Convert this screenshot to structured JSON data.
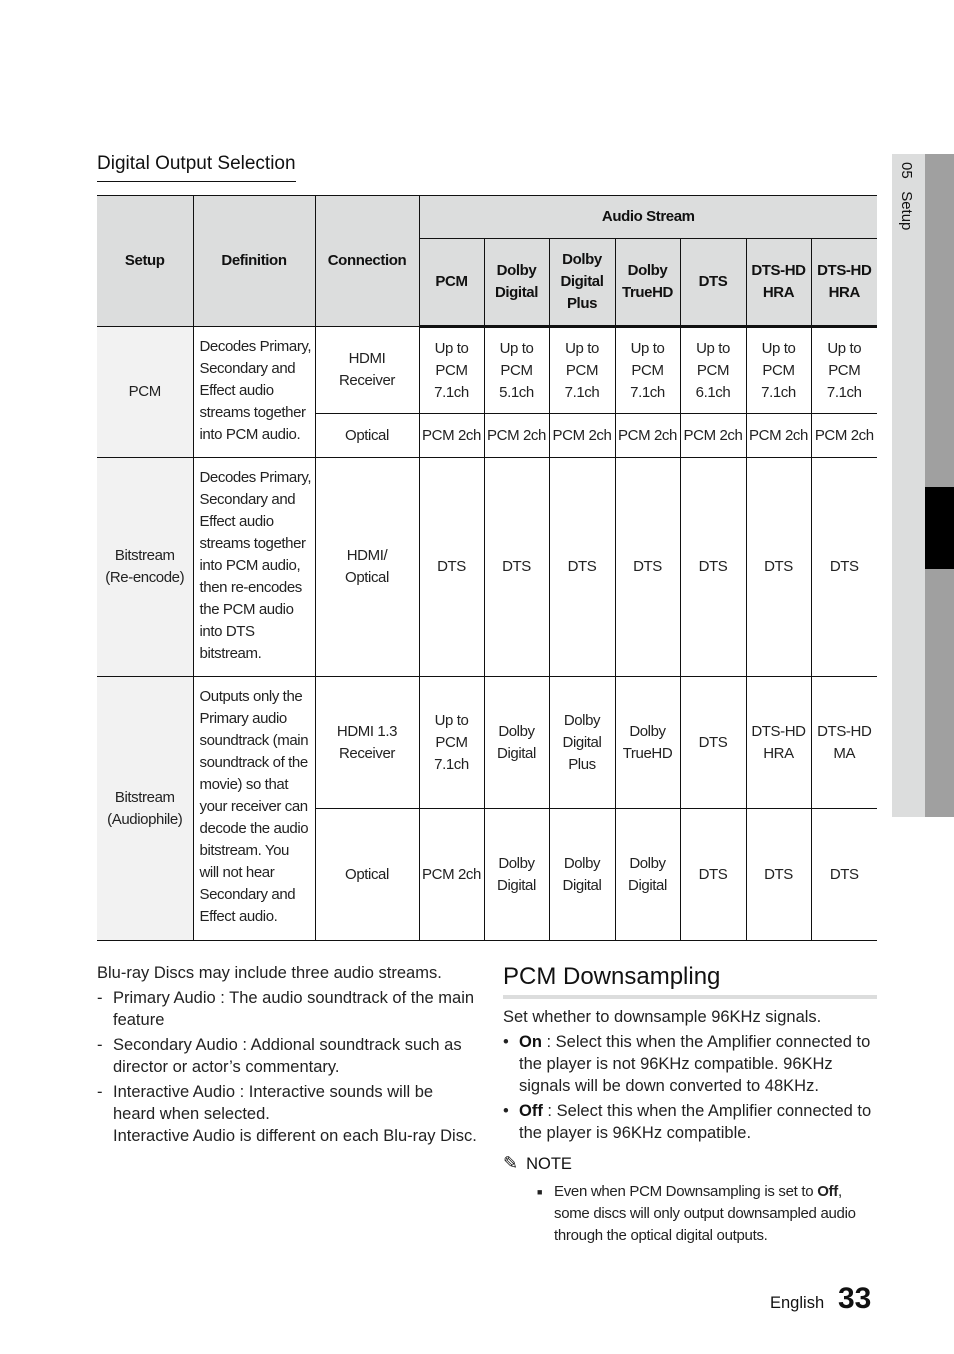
{
  "side_tab": {
    "chapter": "05",
    "label": "Setup"
  },
  "section_title": "Digital Output Selection",
  "table": {
    "headers": {
      "setup": "Setup",
      "definition": "Definition",
      "connection": "Connection",
      "audio_stream": "Audio Stream",
      "streams": [
        "PCM",
        "Dolby\nDigital",
        "Dolby\nDigital\nPlus",
        "Dolby\nTrueHD",
        "DTS",
        "DTS-HD\nHRA",
        "DTS-HD\nHRA"
      ]
    },
    "groups": [
      {
        "setup": "PCM",
        "definition": "Decodes Primary, Secondary and Effect audio streams together into PCM audio.",
        "rows": [
          {
            "connection": "HDMI\nReceiver",
            "values": [
              "Up to\nPCM\n7.1ch",
              "Up to\nPCM\n5.1ch",
              "Up to\nPCM\n7.1ch",
              "Up to\nPCM\n7.1ch",
              "Up to\nPCM\n6.1ch",
              "Up to\nPCM\n7.1ch",
              "Up to\nPCM\n7.1ch"
            ]
          },
          {
            "connection": "Optical",
            "values": [
              "PCM 2ch",
              "PCM 2ch",
              "PCM 2ch",
              "PCM 2ch",
              "PCM 2ch",
              "PCM 2ch",
              "PCM 2ch"
            ]
          }
        ]
      },
      {
        "setup": "Bitstream\n(Re-encode)",
        "definition": "Decodes Primary, Secondary and Effect audio streams together into PCM audio, then re-encodes the PCM audio into DTS bitstream.",
        "rows": [
          {
            "connection": "HDMI/\nOptical",
            "values": [
              "DTS",
              "DTS",
              "DTS",
              "DTS",
              "DTS",
              "DTS",
              "DTS"
            ]
          }
        ]
      },
      {
        "setup": "Bitstream\n(Audiophile)",
        "definition": "Outputs only the Primary audio soundtrack (main soundtrack of the movie) so that your receiver can decode the audio bitstream. You will not hear Secondary and Effect audio.",
        "rows": [
          {
            "connection": "HDMI 1.3\nReceiver",
            "values": [
              "Up to\nPCM\n7.1ch",
              "Dolby\nDigital",
              "Dolby\nDigital\nPlus",
              "Dolby\nTrueHD",
              "DTS",
              "DTS-HD\nHRA",
              "DTS-HD\nMA"
            ]
          },
          {
            "connection": "Optical",
            "values": [
              "PCM 2ch",
              "Dolby\nDigital",
              "Dolby\nDigital",
              "Dolby\nDigital",
              "DTS",
              "DTS",
              "DTS"
            ]
          }
        ]
      }
    ]
  },
  "left_notes": {
    "intro": "Blu-ray Discs may include three audio streams.",
    "items": [
      {
        "bullet": "-",
        "text": "Primary Audio : The audio soundtrack of the main feature"
      },
      {
        "bullet": "-",
        "text": "Secondary Audio : Addional soundtrack such as director or actor’s commentary."
      },
      {
        "bullet": "-",
        "text": "Interactive Audio : Interactive sounds will be heard when selected.",
        "extra": "Interactive Audio is different on each Blu-ray Disc."
      }
    ]
  },
  "pcm_downsampling": {
    "title": "PCM Downsampling",
    "intro": "Set whether to downsample 96KHz signals.",
    "options": [
      {
        "bullet": "•",
        "label": "On",
        "text": " : Select this when the Amplifier connected to the player is not 96KHz compatible. 96KHz signals will be down converted to 48KHz."
      },
      {
        "bullet": "•",
        "label": "Off",
        "text": " : Select this when the Amplifier connected to the player is 96KHz compatible."
      }
    ],
    "note": {
      "icon": "✎",
      "heading": "NOTE",
      "bullet": "■",
      "text_before": "Even when PCM Downsampling is set to ",
      "bold": "Off",
      "text_after": ", some discs will only output downsampled audio through the optical digital outputs."
    }
  },
  "footer": {
    "language": "English",
    "page_number": "33"
  }
}
